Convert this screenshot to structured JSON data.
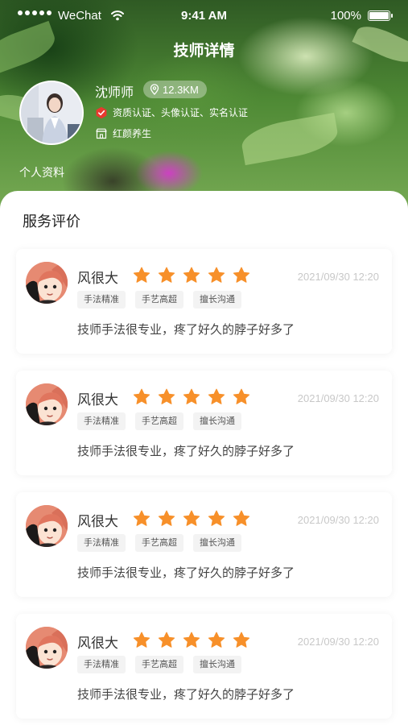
{
  "status_bar": {
    "carrier": "WeChat",
    "time": "9:41 AM",
    "battery": "100%"
  },
  "header": {
    "title": "技师详情"
  },
  "technician": {
    "name": "沈师师",
    "distance": "12.3KM",
    "certifications": "资质认证、头像认证、实名认证",
    "shop": "红颜养生",
    "profile_link": "个人资料"
  },
  "reviews_section": {
    "title": "服务评价",
    "reviews": [
      {
        "name": "风很大",
        "rating": 5,
        "date": "2021/09/30 12:20",
        "tags": [
          "手法精准",
          "手艺高超",
          "擅长沟通"
        ],
        "text": "技师手法很专业，疼了好久的脖子好多了"
      },
      {
        "name": "风很大",
        "rating": 5,
        "date": "2021/09/30 12:20",
        "tags": [
          "手法精准",
          "手艺高超",
          "擅长沟通"
        ],
        "text": "技师手法很专业，疼了好久的脖子好多了"
      },
      {
        "name": "风很大",
        "rating": 5,
        "date": "2021/09/30 12:20",
        "tags": [
          "手法精准",
          "手艺高超",
          "擅长沟通"
        ],
        "text": "技师手法很专业，疼了好久的脖子好多了"
      },
      {
        "name": "风很大",
        "rating": 5,
        "date": "2021/09/30 12:20",
        "tags": [
          "手法精准",
          "手艺高超",
          "擅长沟通"
        ],
        "text": "技师手法很专业，疼了好久的脖子好多了"
      }
    ]
  },
  "colors": {
    "star": "#f7902a",
    "cert_badge": "#e8392f",
    "accent_bg": "#4f8a35"
  }
}
